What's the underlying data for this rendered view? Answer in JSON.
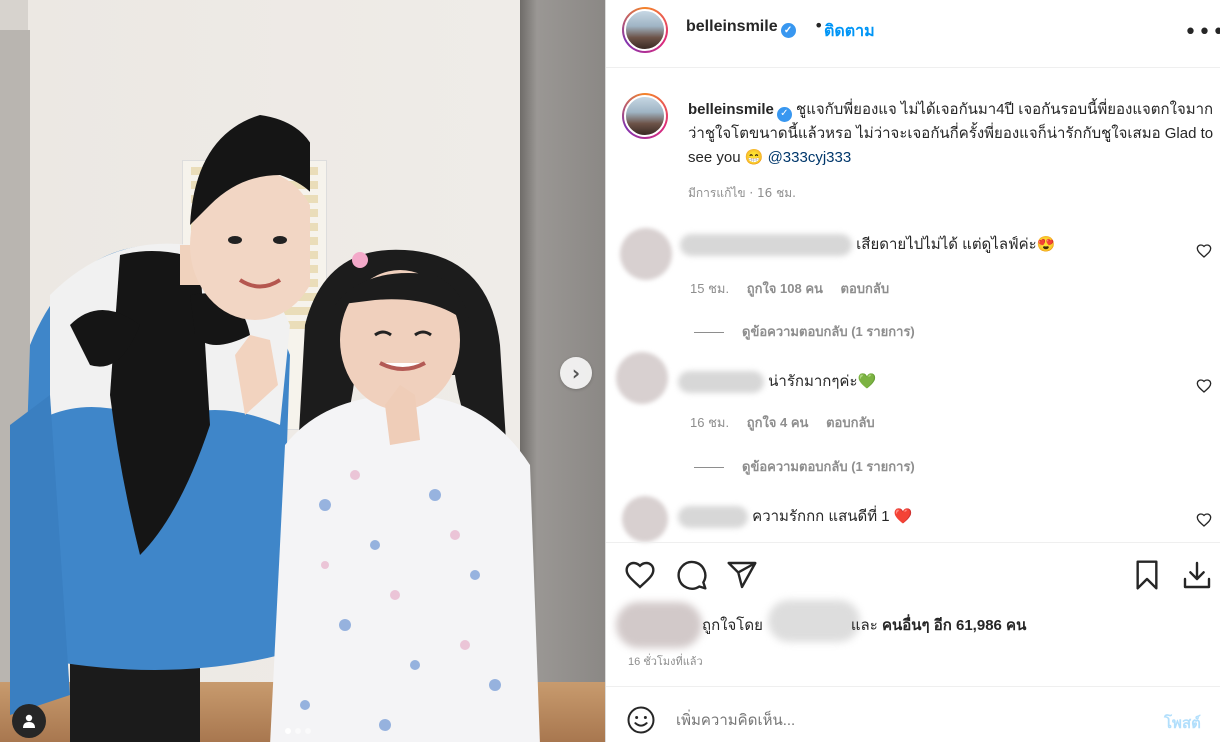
{
  "header": {
    "username": "belleinsmile",
    "verified_mark": "✓",
    "separator": "•",
    "follow_label": "ติดตาม",
    "more_label": "•••"
  },
  "caption": {
    "username": "belleinsmile",
    "text": "ชูแจกับพี่ยองแจ ไม่ได้เจอกันมา4ปี เจอกันรอบนี้พี่ยองแจตกใจมาก ว่าชูใจโตขนาดนี้แล้วหรอ ไม่ว่าจะเจอกันกี่ครั้งพี่ยองแจก็น่ารักกับชูใจเสมอ Glad to see you 😁",
    "mention": "@333cyj333",
    "meta": "มีการแก้ไข · 16 ชม."
  },
  "comments": [
    {
      "text": "เสียดายไปไม่ได้ แต่ดูไลฟ์ค่ะ😍",
      "time": "15 ชม.",
      "likes": "ถูกใจ 108 คน",
      "reply": "ตอบกลับ",
      "view_replies": "ดูข้อความตอบกลับ (1 รายการ)"
    },
    {
      "text": "น่ารักมากๆค่ะ💚",
      "time": "16 ชม.",
      "likes": "ถูกใจ 4 คน",
      "reply": "ตอบกลับ",
      "view_replies": "ดูข้อความตอบกลับ (1 รายการ)"
    },
    {
      "text": "ความรักกก แสนดีที่ 1 ❤️"
    }
  ],
  "likes": {
    "liked_by": "ถูกใจโดย",
    "and": "และ",
    "others": "คนอื่นๆ อีก 61,986 คน"
  },
  "posted_time": "16 ชั่วโมงที่แล้ว",
  "add_comment": {
    "placeholder": "เพิ่มความคิดเห็น...",
    "post_label": "โพสต์"
  },
  "photo": {
    "next_label": "›",
    "carousel": {
      "total": 3,
      "current": 1
    }
  },
  "colors": {
    "accent": "#0095f6",
    "text": "#262626",
    "muted": "#8e8e8e",
    "verified": "#3897f0"
  }
}
